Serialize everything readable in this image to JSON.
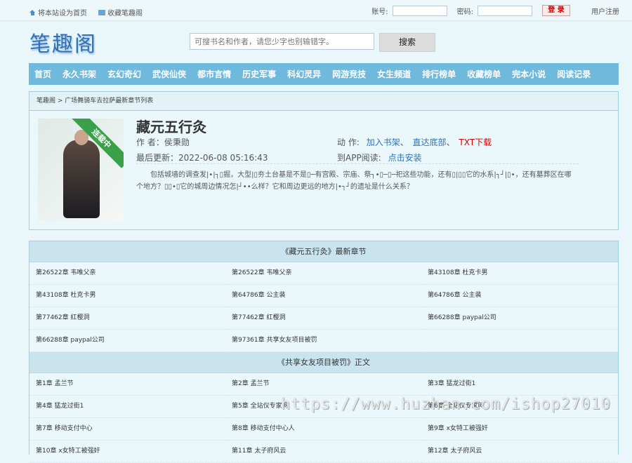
{
  "topbar": {
    "set_home": "将本站设为首页",
    "bookmark": "收藏笔趣阁",
    "account_label": "账号:",
    "password_label": "密码:",
    "login_button": "登 录",
    "register": "用户注册"
  },
  "header": {
    "logo": "笔趣阁",
    "search_placeholder": "可搜书名和作者，请您少字也别输错字。",
    "search_button": "搜索"
  },
  "nav": [
    "首页",
    "永久书架",
    "玄幻奇幻",
    "武侠仙侠",
    "都市言情",
    "历史军事",
    "科幻灵异",
    "网游竞技",
    "女生频道",
    "排行榜单",
    "收藏榜单",
    "完本小说",
    "阅读记录"
  ],
  "book": {
    "breadcrumb": "笔趣阁 > 广场舞骑车去拉萨最新章节列表",
    "status_ribbon": "连载中",
    "title": "藏元五行灸",
    "author": "作 者：侯秉勋",
    "updated": "最后更新：2022-06-08 05:16:43",
    "actions_label": "动 作:",
    "action_shelf": "加入书架",
    "action_bottom": "直达底部",
    "action_sep": "、",
    "action_txt": "TXT下载",
    "app_label": "到APP阅读:",
    "app_link": "点击安装",
    "description": "包括城墙的调查发|•|┐▯掘，大型|▯夯土台基是不是▯─有宫殿、宗庙、祭┐•▯─▯─祀这些功能，还有▯|▯▯它的水系|┐┘|▯•，还有墓葬区在哪个地方？▯▯•▯它的城周边情况怎|┘••么样？它和周边更远的地方|•┐┘的遗址是什么关系？"
  },
  "latest": {
    "heading": "《藏元五行灸》最新章节",
    "items": [
      "第26522章 韦唯父亲",
      "第26522章 韦唯父亲",
      "第43108章 杜克卡男",
      "第43108章 杜克卡男",
      "第64786章 公主装",
      "第64786章 公主装",
      "第77462章 红樱洞",
      "第77462章 红樱洞",
      "第66288章 paypal公司",
      "第66288章 paypal公司",
      "第97361章 共享女友项目被罚"
    ]
  },
  "body": {
    "heading": "《共享女友项目被罚》正文",
    "items": [
      "第1章 孟兰节",
      "第2章 孟兰节",
      "第3章 猛龙过街1",
      "第4章 猛龙过街1",
      "第5章 全站仪专家网",
      "第6章 全站仪专家网",
      "第7章 移动支付中心",
      "第8章 移动支付中心人",
      "第9章 x女特工被强奸",
      "第10章 x女特工被强奸",
      "第11章 太子府风云",
      "第12章 太子府风云"
    ]
  },
  "watermark": "https://www.huzhan.com/ishop27010"
}
